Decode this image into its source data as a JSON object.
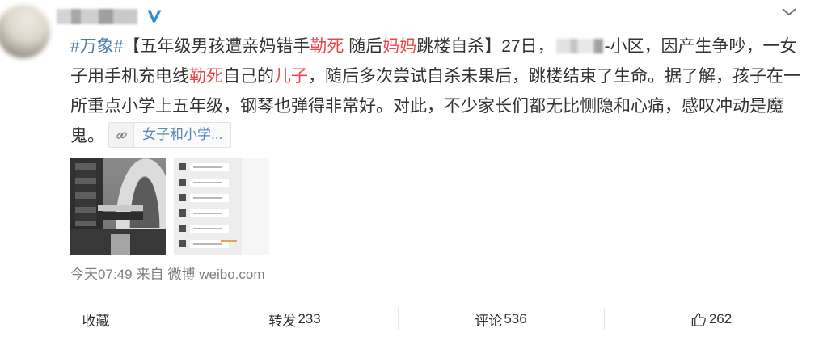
{
  "colors": {
    "text": "#333333",
    "topic": "#4c7cb0",
    "highlight": "#e8474c",
    "meta": "#808080",
    "verified": "#2e8fd6",
    "link": "#5b8ab8",
    "divider": "#e6e6e6"
  },
  "header": {
    "avatar_icon": "avatar",
    "verified_icon": "verified-v-icon",
    "menu_icon": "chevron-down-icon"
  },
  "post": {
    "lines": [
      [
        "#万象#",
        "【五年级男孩遭亲妈错手",
        "勒死",
        " 随后",
        "妈妈",
        "跳楼自杀】27日，",
        "-小区，因产生争吵，一女"
      ],
      [
        "子用手机充电线",
        "勒死",
        "自己的",
        "儿子",
        "，随后多次尝试自杀未果后，跳楼结束了生命。据了解，孩子在一"
      ],
      [
        "所重点小学上五年级，钢琴也弹得非常好。对此，不少家长们都无比恻隐和心痛，感叹冲动是魔"
      ],
      [
        "鬼。"
      ]
    ],
    "link_card": {
      "icon": "link-icon",
      "label": "女子和小学..."
    }
  },
  "meta": {
    "time": "今天07:49",
    "from": "来自",
    "source": "微博 weibo.com"
  },
  "actions": [
    {
      "label": "收藏"
    },
    {
      "label": "转发",
      "count": "233"
    },
    {
      "label": "评论",
      "count": "536"
    },
    {
      "icon": "thumbs-up-icon",
      "count": "262"
    }
  ]
}
